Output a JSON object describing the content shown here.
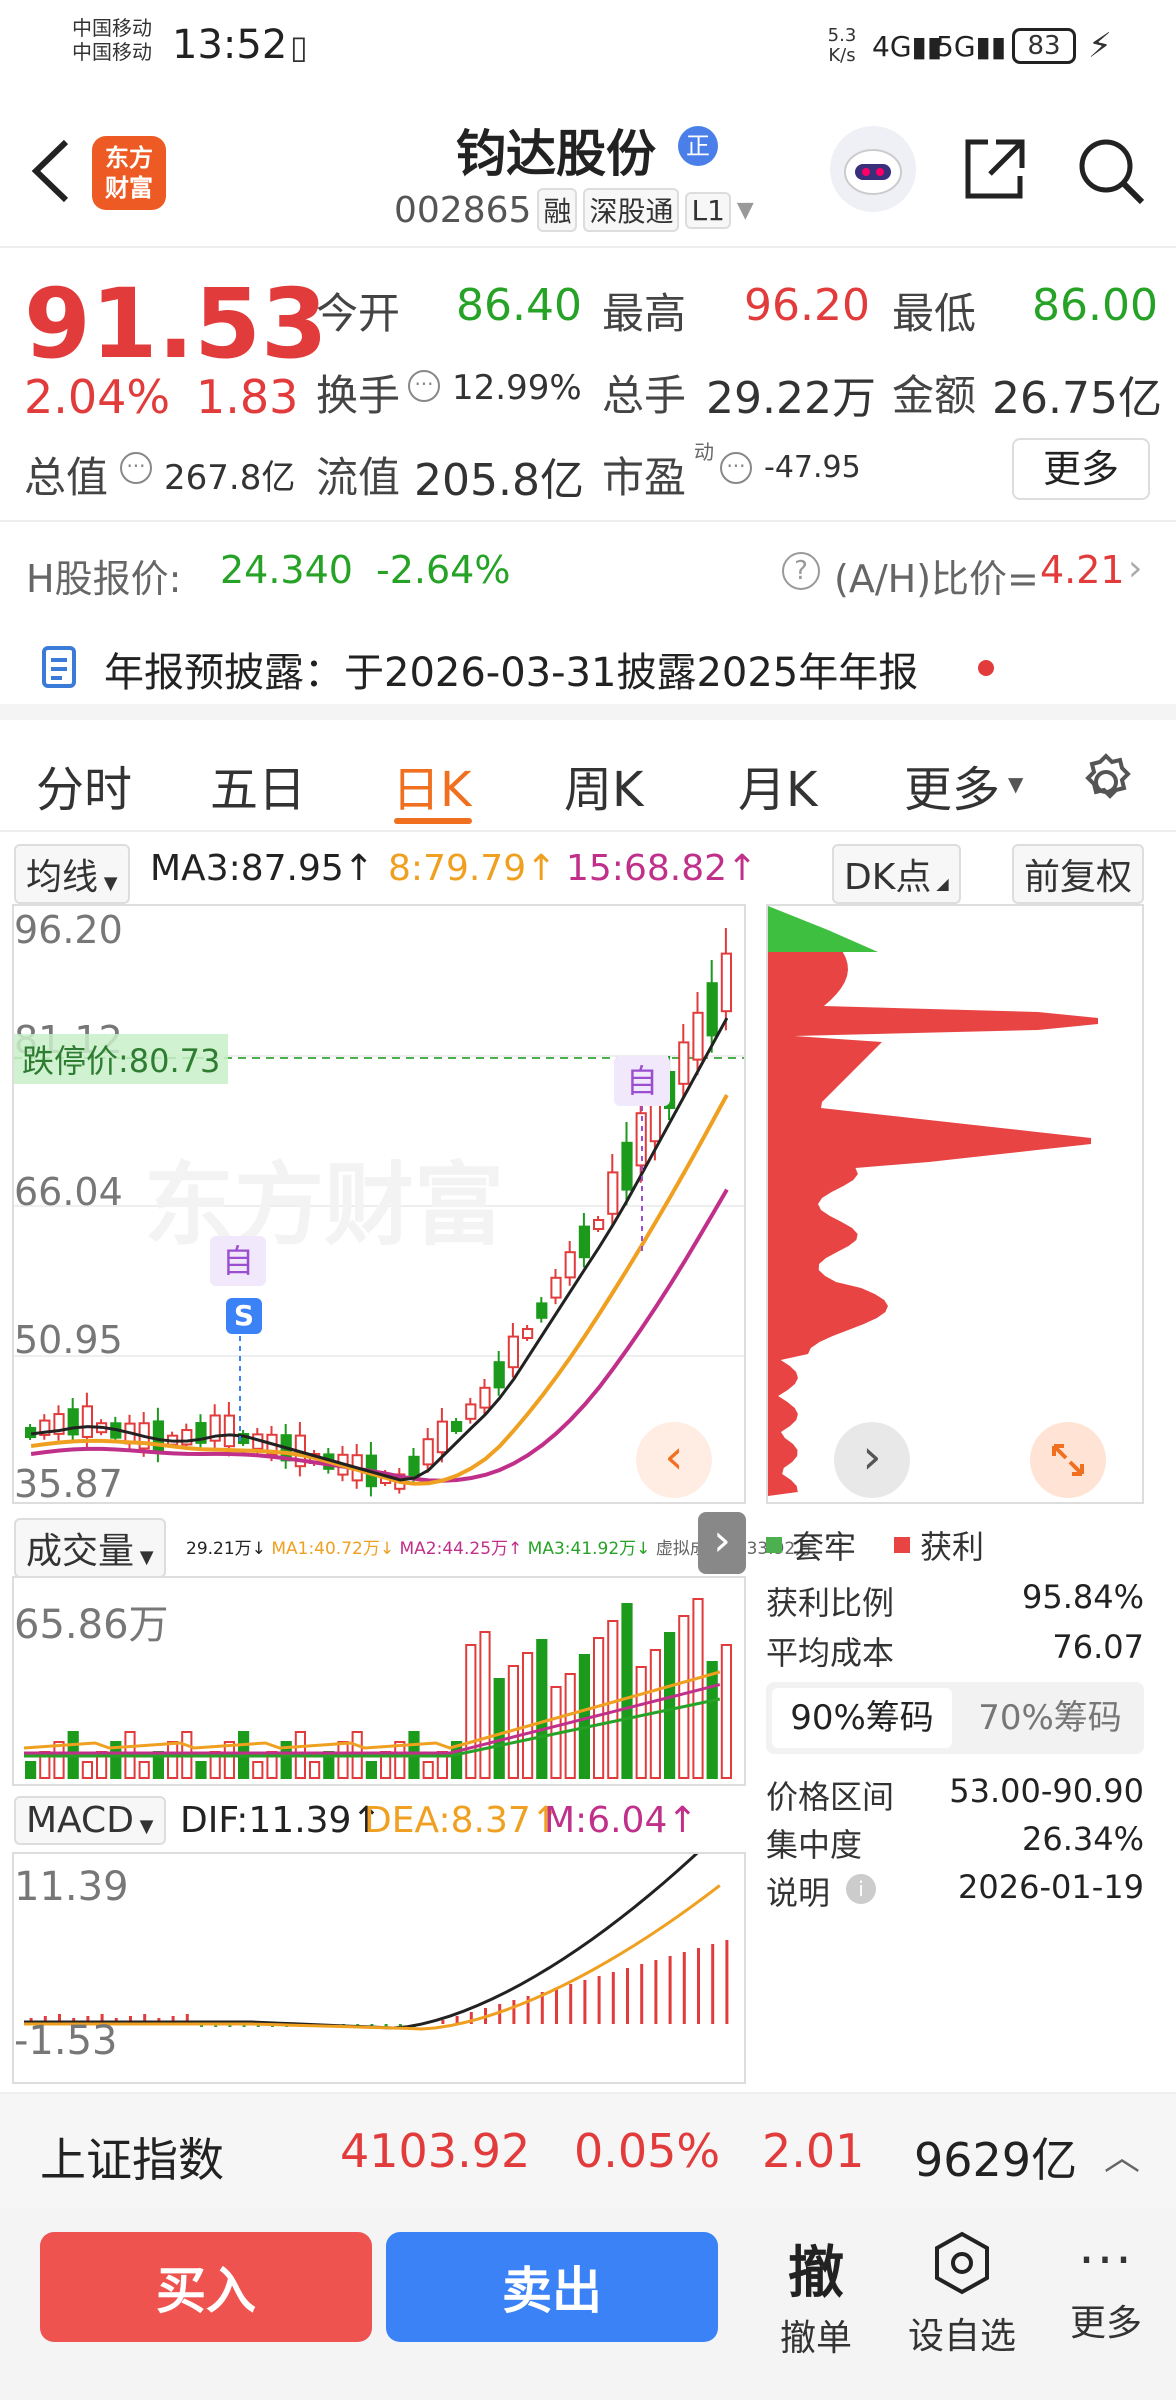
{
  "status": {
    "carrier1": "中国移动",
    "carrier2": "中国移动",
    "time": "13:52",
    "speed": "5.3\nK/s",
    "battery": "83"
  },
  "header": {
    "logo": "东方\n财富",
    "name": "钧达股份",
    "badge": "正",
    "code": "002865",
    "tag1": "融",
    "tag2": "深股通",
    "tag3": "L1"
  },
  "quote": {
    "price": "91.53",
    "pct": "2.04%",
    "chg": "1.83",
    "open_label": "今开",
    "open": "86.40",
    "high_label": "最高",
    "high": "96.20",
    "low_label": "最低",
    "low": "86.00",
    "turnover_label": "换手",
    "turnover": "12.99%",
    "volume_label": "总手",
    "volume": "29.22万",
    "amount_label": "金额",
    "amount": "26.75亿",
    "mktcap_label": "总值",
    "mktcap": "267.8亿",
    "float_label": "流值",
    "float": "205.8亿",
    "pe_label": "市盈",
    "pe_sup": "动",
    "pe": "-47.95",
    "more": "更多"
  },
  "hshare": {
    "label": "H股报价:",
    "price": "24.340",
    "pct": "-2.64%",
    "ratio_label": "(A/H)比价=",
    "ratio": "4.21"
  },
  "announcement": {
    "text": "年报预披露：于2026-03-31披露2025年年报"
  },
  "tabs": [
    "分时",
    "五日",
    "日K",
    "周K",
    "月K",
    "更多"
  ],
  "active_tab": "日K",
  "ma": {
    "selector": "均线",
    "ma3": "MA3:87.95↑",
    "ma8": "8:79.79↑",
    "ma15": "15:68.82↑",
    "dk": "DK点",
    "adjust": "前复权"
  },
  "main_chart": {
    "y_labels": [
      "96.20",
      "81.12",
      "66.04",
      "50.95",
      "35.87"
    ],
    "limit_label": "跌停价:80.73",
    "marker_self": "自",
    "marker_s": "S",
    "watermark": "东方财富"
  },
  "volume": {
    "selector": "成交量",
    "v": "29.21万↓",
    "ma1": "MA1:40.72万↓",
    "ma2": "MA2:44.25万↑",
    "ma3": "MA3:41.92万↓",
    "virt": "虚拟成交量:33.92万",
    "ymax": "65.86万"
  },
  "macd": {
    "selector": "MACD",
    "dif": "DIF:11.39↑",
    "dea": "DEA:8.37↑",
    "m": "M:6.04↑",
    "ymax": "11.39",
    "ymin": "-1.53"
  },
  "distribution": {
    "legend_locked": "套牢",
    "legend_profit": "获利",
    "profit_ratio_label": "获利比例",
    "profit_ratio": "95.84%",
    "avg_cost_label": "平均成本",
    "avg_cost": "76.07",
    "tab90": "90%筹码",
    "tab70": "70%筹码",
    "range_label": "价格区间",
    "range": "53.00-90.90",
    "conc_label": "集中度",
    "conc": "26.34%",
    "note_label": "说明",
    "note": "2026-01-19"
  },
  "index_bar": {
    "name": "上证指数",
    "value": "4103.92",
    "pct": "0.05%",
    "chg": "2.01",
    "amount": "9629亿"
  },
  "bottom": {
    "buy": "买入",
    "sell": "卖出",
    "cancel_icon": "撤",
    "cancel": "撤单",
    "watch": "设自选",
    "more": "更多"
  },
  "colors": {
    "up": "#e23b3b",
    "down": "#26a326",
    "accent": "#f07020",
    "buy": "#ef5350",
    "sell": "#3b82f6",
    "ma3": "#222222",
    "ma8": "#f0a020",
    "ma15": "#c0308a"
  }
}
